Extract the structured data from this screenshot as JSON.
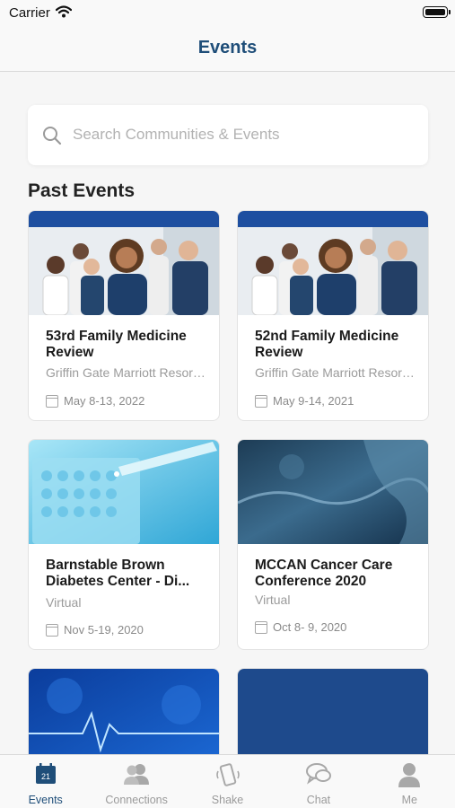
{
  "status_bar": {
    "carrier": "Carrier"
  },
  "nav": {
    "title": "Events"
  },
  "search": {
    "placeholder": "Search Communities & Events"
  },
  "section": {
    "title": "Past Events"
  },
  "events": [
    {
      "name": "53rd Family Medicine Review",
      "venue": "Griffin Gate Marriott Resort ...",
      "date": "May 8-13, 2022",
      "image": "doctors-group"
    },
    {
      "name": "52nd Family Medicine Review",
      "venue": "Griffin Gate Marriott Resort ...",
      "date": "May 9-14, 2021",
      "image": "doctors-group"
    },
    {
      "name": "Barnstable Brown Diabetes Center - Di...",
      "venue": "Virtual",
      "date": "Nov 5-19, 2020",
      "image": "lab-pipette"
    },
    {
      "name": "MCCAN Cancer Care Conference 2020",
      "venue": "Virtual",
      "date": "Oct 8- 9, 2020",
      "image": "blue-texture"
    },
    {
      "image": "heartbeat-blue"
    },
    {
      "image": "solid-blue"
    }
  ],
  "tabs": [
    {
      "label": "Events",
      "icon": "calendar-icon",
      "badge": "21",
      "active": true
    },
    {
      "label": "Connections",
      "icon": "people-icon",
      "active": false
    },
    {
      "label": "Shake",
      "icon": "shake-phone-icon",
      "active": false
    },
    {
      "label": "Chat",
      "icon": "chat-icon",
      "active": false
    },
    {
      "label": "Me",
      "icon": "person-icon",
      "active": false
    }
  ],
  "colors": {
    "accent": "#1f4e79",
    "card_header": "#1e4fa0"
  }
}
